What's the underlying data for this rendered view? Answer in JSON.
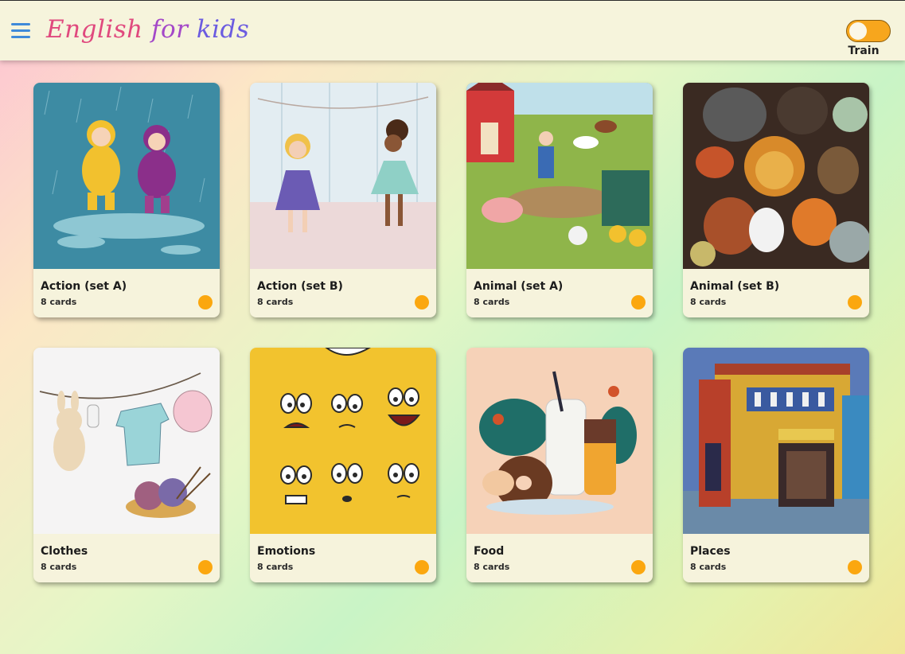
{
  "header": {
    "title_words": [
      "English",
      "for",
      "kids"
    ],
    "menu_icon": "hamburger-menu-icon",
    "toggle_label": "Train",
    "toggle_on": true
  },
  "colors": {
    "header_bg": "#f6f4dc",
    "accent_orange": "#fba70f",
    "menu_blue": "#3f8ad9",
    "title_pink": "#e0497e",
    "title_purple": "#a448c8",
    "title_violet": "#6b5be0"
  },
  "cards": [
    {
      "title": "Action (set A)",
      "count": "8 cards",
      "image": "kids-playing-in-rain-illustration"
    },
    {
      "title": "Action (set B)",
      "count": "8 cards",
      "image": "girls-dancing-illustration"
    },
    {
      "title": "Animal (set A)",
      "count": "8 cards",
      "image": "farm-animals-illustration"
    },
    {
      "title": "Animal (set B)",
      "count": "8 cards",
      "image": "wild-animals-collage-illustration"
    },
    {
      "title": "Clothes",
      "count": "8 cards",
      "image": "baby-clothes-on-line-illustration"
    },
    {
      "title": "Emotions",
      "count": "8 cards",
      "image": "cartoon-faces-pattern-illustration"
    },
    {
      "title": "Food",
      "count": "8 cards",
      "image": "donuts-and-drinks-illustration"
    },
    {
      "title": "Places",
      "count": "8 cards",
      "image": "colorful-house-painting-illustration"
    }
  ]
}
